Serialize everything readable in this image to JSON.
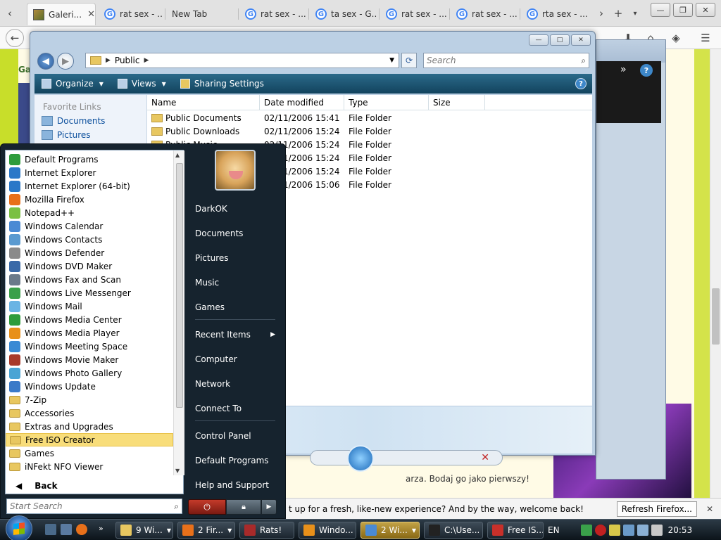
{
  "browser": {
    "tabs": [
      {
        "label": "Galeri...",
        "active": true,
        "icon": "picture-favicon"
      },
      {
        "label": "rat sex - ...",
        "icon": "google-favicon"
      },
      {
        "label": "New Tab",
        "icon": ""
      },
      {
        "label": "rat sex - ...",
        "icon": "google-favicon"
      },
      {
        "label": "ta sex - G...",
        "icon": "google-favicon"
      },
      {
        "label": "rat sex - ...",
        "icon": "google-favicon"
      },
      {
        "label": "rat sex - ...",
        "icon": "google-favicon"
      },
      {
        "label": "rta sex - ...",
        "icon": "google-favicon"
      }
    ],
    "google_glyph": "G",
    "close_glyph": "✕",
    "new_tab_glyph": "+",
    "notification": {
      "message": "t up for a fresh, like-new experience? And by the way, welcome back!",
      "button": "Refresh Firefox...",
      "close": "✕"
    },
    "page_fragment": "arza. Bodaj go jako pierwszy!",
    "page_ga": "Ga"
  },
  "explorer": {
    "breadcrumb": "Public",
    "search_placeholder": "Search",
    "commands": [
      {
        "label": "Organize"
      },
      {
        "label": "Views"
      },
      {
        "label": "Sharing Settings"
      }
    ],
    "help_glyph": "?",
    "favorite_links_header": "Favorite Links",
    "favorite_links": [
      "Documents",
      "Pictures"
    ],
    "columns": [
      "Name",
      "Date modified",
      "Type",
      "Size"
    ],
    "files": [
      {
        "name": "Public Documents",
        "date": "02/11/2006 15:41",
        "type": "File Folder",
        "size": ""
      },
      {
        "name": "Public Downloads",
        "date": "02/11/2006 15:24",
        "type": "File Folder",
        "size": ""
      },
      {
        "name": "Public Music",
        "date": "02/11/2006 15:24",
        "type": "File Folder",
        "size": ""
      },
      {
        "name": "",
        "date": "02/11/2006 15:24",
        "type": "File Folder",
        "size": ""
      },
      {
        "name": "",
        "date": "02/11/2006 15:24",
        "type": "File Folder",
        "size": ""
      },
      {
        "name": "",
        "date": "02/11/2006 15:06",
        "type": "File Folder",
        "size": ""
      }
    ]
  },
  "startmenu": {
    "programs": [
      {
        "label": "Default Programs",
        "icon": "#2e9c3c"
      },
      {
        "label": "Internet Explorer",
        "icon": "#2a78c8"
      },
      {
        "label": "Internet Explorer (64-bit)",
        "icon": "#2a78c8"
      },
      {
        "label": "Mozilla Firefox",
        "icon": "#e8701a"
      },
      {
        "label": "Notepad++",
        "icon": "#7ac043"
      },
      {
        "label": "Windows Calendar",
        "icon": "#4a8ad4"
      },
      {
        "label": "Windows Contacts",
        "icon": "#5a9ad0"
      },
      {
        "label": "Windows Defender",
        "icon": "#8a8a8a"
      },
      {
        "label": "Windows DVD Maker",
        "icon": "#3a6aa8"
      },
      {
        "label": "Windows Fax and Scan",
        "icon": "#6a7a8a"
      },
      {
        "label": "Windows Live Messenger",
        "icon": "#3aa04a"
      },
      {
        "label": "Windows Mail",
        "icon": "#6ab4e4"
      },
      {
        "label": "Windows Media Center",
        "icon": "#2e9c3c"
      },
      {
        "label": "Windows Media Player",
        "icon": "#e8901a"
      },
      {
        "label": "Windows Meeting Space",
        "icon": "#3a8ad4"
      },
      {
        "label": "Windows Movie Maker",
        "icon": "#a83a2a"
      },
      {
        "label": "Windows Photo Gallery",
        "icon": "#4aa4d4"
      },
      {
        "label": "Windows Update",
        "icon": "#3a7ac8"
      },
      {
        "label": "7-Zip",
        "icon": "folder"
      },
      {
        "label": "Accessories",
        "icon": "folder"
      },
      {
        "label": "Extras and Upgrades",
        "icon": "folder"
      },
      {
        "label": "Free ISO Creator",
        "icon": "folder",
        "selected": true
      },
      {
        "label": "Games",
        "icon": "folder"
      },
      {
        "label": "iNFekt NFO Viewer",
        "icon": "folder"
      }
    ],
    "back_label": "Back",
    "search_placeholder": "Start Search",
    "right_items": [
      {
        "label": "DarkOK"
      },
      {
        "label": "Documents"
      },
      {
        "label": "Pictures"
      },
      {
        "label": "Music"
      },
      {
        "label": "Games",
        "sep_after": true
      },
      {
        "label": "Recent Items",
        "submenu": true
      },
      {
        "label": "Computer"
      },
      {
        "label": "Network"
      },
      {
        "label": "Connect To",
        "sep_after": true
      },
      {
        "label": "Control Panel"
      },
      {
        "label": "Default Programs"
      },
      {
        "label": "Help and Support"
      }
    ]
  },
  "taskbar": {
    "buttons": [
      {
        "label": "9 Wi...",
        "icon": "#e8c760",
        "dropdown": true
      },
      {
        "label": "2 Fir...",
        "icon": "#e8701a",
        "dropdown": true
      },
      {
        "label": "Rats!",
        "icon": "#a82a2a"
      },
      {
        "label": "Windo...",
        "icon": "#e8901a"
      },
      {
        "label": "2 Wi...",
        "icon": "#4a8ad4",
        "dropdown": true,
        "highlight": true
      },
      {
        "label": "C:\\Use...",
        "icon": "#222222"
      },
      {
        "label": "Free IS...",
        "icon": "#c8302a"
      }
    ],
    "language": "EN",
    "clock": "20:53"
  }
}
